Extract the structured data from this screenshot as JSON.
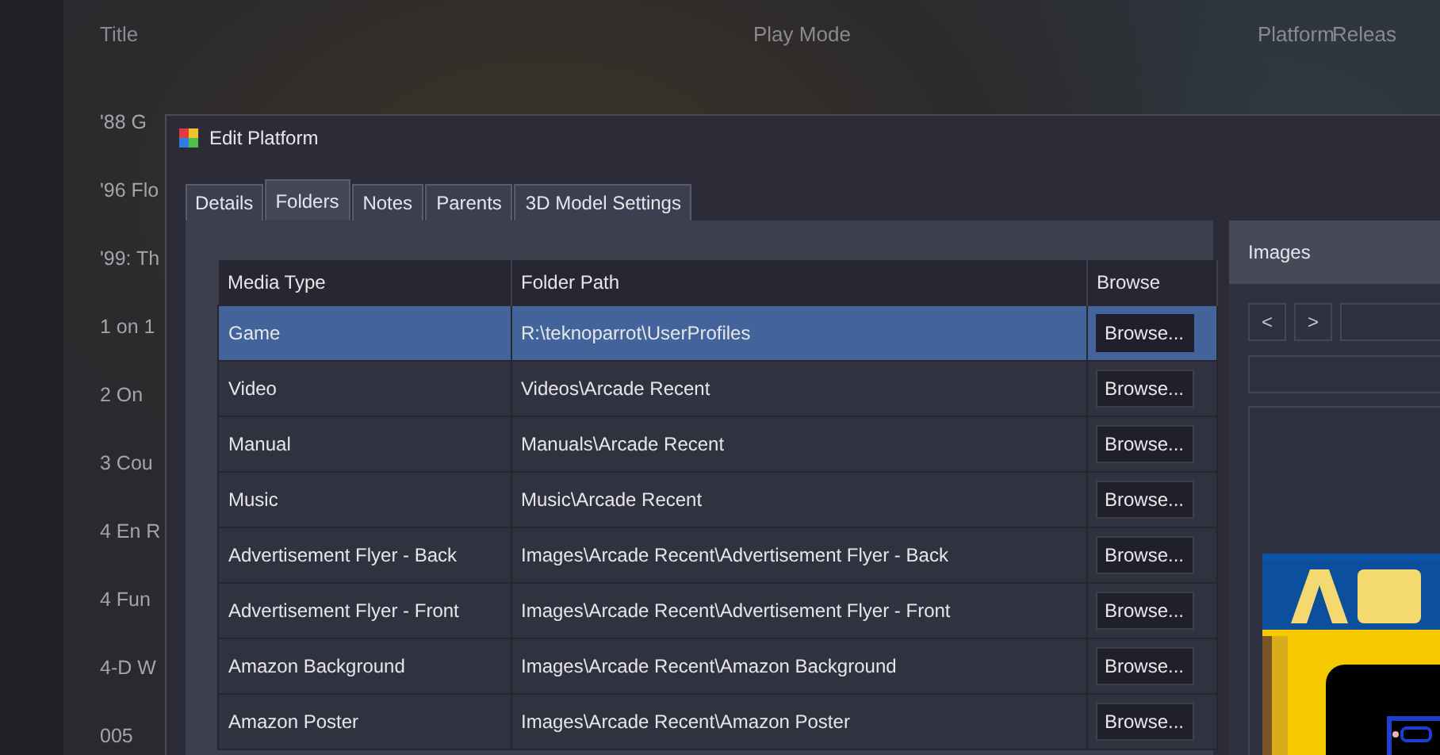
{
  "background_list": {
    "columns": [
      "Title",
      "Play Mode",
      "Platform",
      "Releas"
    ],
    "titles": [
      "'88 G",
      "'96 Flo",
      "'99: Th",
      "1 on 1",
      "2 On",
      "3 Cou",
      "4 En R",
      "4 Fun",
      "4-D W",
      "005"
    ]
  },
  "dialog": {
    "title": "Edit Platform",
    "tabs": [
      {
        "label": "Details",
        "selected": false
      },
      {
        "label": "Folders",
        "selected": true
      },
      {
        "label": "Notes",
        "selected": false
      },
      {
        "label": "Parents",
        "selected": false
      },
      {
        "label": "3D Model Settings",
        "selected": false
      }
    ],
    "table": {
      "columns": [
        "Media Type",
        "Folder Path",
        "Browse"
      ],
      "rows": [
        {
          "media_type": "Game",
          "folder_path": "R:\\teknoparrot\\UserProfiles",
          "button": "Browse...",
          "selected": true
        },
        {
          "media_type": "Video",
          "folder_path": "Videos\\Arcade Recent",
          "button": "Browse...",
          "selected": false
        },
        {
          "media_type": "Manual",
          "folder_path": "Manuals\\Arcade Recent",
          "button": "Browse...",
          "selected": false
        },
        {
          "media_type": "Music",
          "folder_path": "Music\\Arcade Recent",
          "button": "Browse...",
          "selected": false
        },
        {
          "media_type": "Advertisement Flyer - Back",
          "folder_path": "Images\\Arcade Recent\\Advertisement Flyer - Back",
          "button": "Browse...",
          "selected": false
        },
        {
          "media_type": "Advertisement Flyer - Front",
          "folder_path": "Images\\Arcade Recent\\Advertisement Flyer - Front",
          "button": "Browse...",
          "selected": false
        },
        {
          "media_type": "Amazon Background",
          "folder_path": "Images\\Arcade Recent\\Amazon Background",
          "button": "Browse...",
          "selected": false
        },
        {
          "media_type": "Amazon Poster",
          "folder_path": "Images\\Arcade Recent\\Amazon Poster",
          "button": "Browse...",
          "selected": false
        }
      ]
    },
    "images_panel": {
      "title": "Images",
      "prev_button": "<",
      "next_button": ">"
    }
  }
}
